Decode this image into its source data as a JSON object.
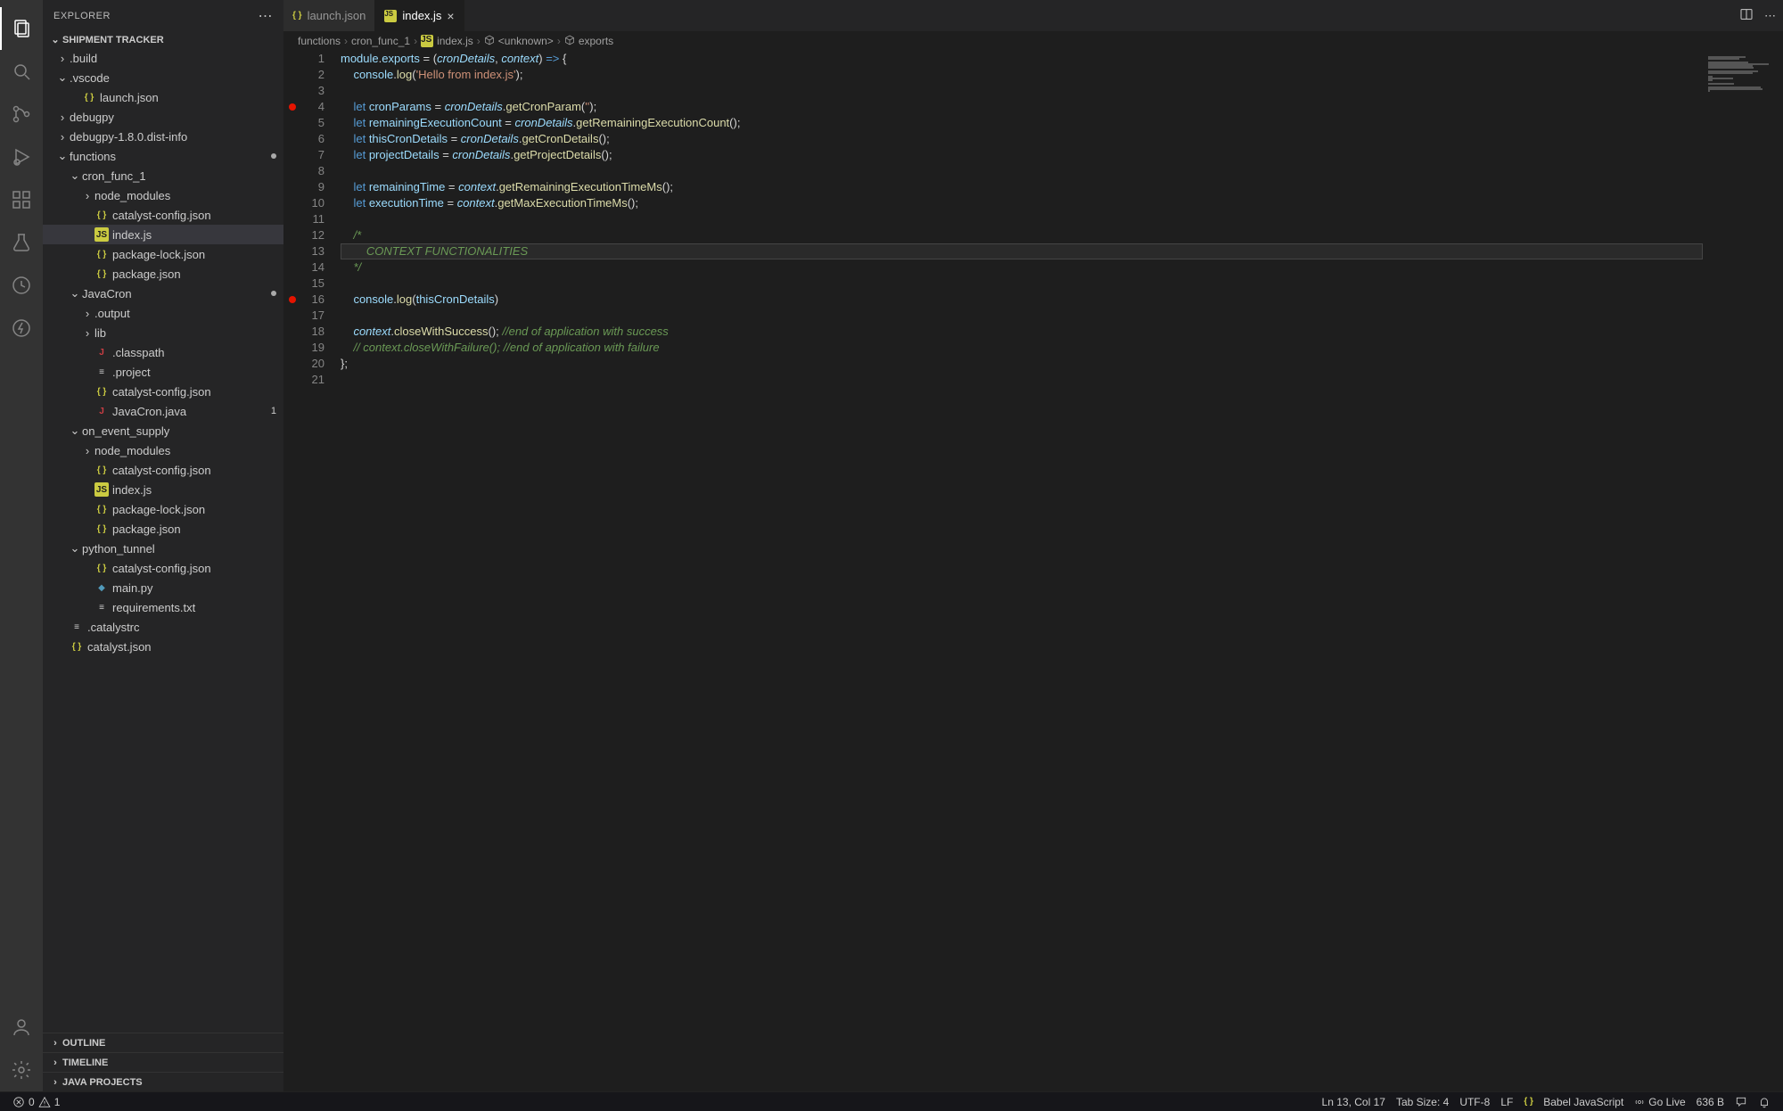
{
  "sidebar": {
    "title": "EXPLORER",
    "root": "SHIPMENT TRACKER",
    "panels": {
      "outline": "OUTLINE",
      "timeline": "TIMELINE",
      "java": "JAVA PROJECTS"
    }
  },
  "tree": [
    {
      "depth": 0,
      "type": "folder",
      "open": false,
      "label": ".build"
    },
    {
      "depth": 0,
      "type": "folder",
      "open": true,
      "label": ".vscode"
    },
    {
      "depth": 1,
      "type": "file",
      "icon": "json",
      "label": "launch.json"
    },
    {
      "depth": 0,
      "type": "folder",
      "open": false,
      "label": "debugpy"
    },
    {
      "depth": 0,
      "type": "folder",
      "open": false,
      "label": "debugpy-1.8.0.dist-info"
    },
    {
      "depth": 0,
      "type": "folder",
      "open": true,
      "label": "functions",
      "dot": true
    },
    {
      "depth": 1,
      "type": "folder",
      "open": true,
      "label": "cron_func_1"
    },
    {
      "depth": 2,
      "type": "folder",
      "open": false,
      "label": "node_modules"
    },
    {
      "depth": 2,
      "type": "file",
      "icon": "json",
      "label": "catalyst-config.json"
    },
    {
      "depth": 2,
      "type": "file",
      "icon": "js",
      "label": "index.js",
      "selected": true
    },
    {
      "depth": 2,
      "type": "file",
      "icon": "json",
      "label": "package-lock.json"
    },
    {
      "depth": 2,
      "type": "file",
      "icon": "json",
      "label": "package.json"
    },
    {
      "depth": 1,
      "type": "folder",
      "open": true,
      "label": "JavaCron",
      "dot": true
    },
    {
      "depth": 2,
      "type": "folder",
      "open": false,
      "label": ".output"
    },
    {
      "depth": 2,
      "type": "folder",
      "open": false,
      "label": "lib"
    },
    {
      "depth": 2,
      "type": "file",
      "icon": "java",
      "label": ".classpath"
    },
    {
      "depth": 2,
      "type": "file",
      "icon": "txt",
      "label": ".project"
    },
    {
      "depth": 2,
      "type": "file",
      "icon": "json",
      "label": "catalyst-config.json"
    },
    {
      "depth": 2,
      "type": "file",
      "icon": "java",
      "label": "JavaCron.java",
      "badge": "1"
    },
    {
      "depth": 1,
      "type": "folder",
      "open": true,
      "label": "on_event_supply"
    },
    {
      "depth": 2,
      "type": "folder",
      "open": false,
      "label": "node_modules"
    },
    {
      "depth": 2,
      "type": "file",
      "icon": "json",
      "label": "catalyst-config.json"
    },
    {
      "depth": 2,
      "type": "file",
      "icon": "js",
      "label": "index.js"
    },
    {
      "depth": 2,
      "type": "file",
      "icon": "json",
      "label": "package-lock.json"
    },
    {
      "depth": 2,
      "type": "file",
      "icon": "json",
      "label": "package.json"
    },
    {
      "depth": 1,
      "type": "folder",
      "open": true,
      "label": "python_tunnel"
    },
    {
      "depth": 2,
      "type": "file",
      "icon": "json",
      "label": "catalyst-config.json"
    },
    {
      "depth": 2,
      "type": "file",
      "icon": "py",
      "label": "main.py"
    },
    {
      "depth": 2,
      "type": "file",
      "icon": "txt",
      "label": "requirements.txt"
    },
    {
      "depth": 0,
      "type": "file",
      "icon": "txt",
      "label": ".catalystrc"
    },
    {
      "depth": 0,
      "type": "file",
      "icon": "json",
      "label": "catalyst.json"
    }
  ],
  "tabs": [
    {
      "icon": "json",
      "label": "launch.json",
      "active": false
    },
    {
      "icon": "js",
      "label": "index.js",
      "active": true,
      "close": true
    }
  ],
  "breadcrumb": [
    "functions",
    "cron_func_1",
    "index.js",
    "<unknown>",
    "exports"
  ],
  "breadcrumb_icons": [
    "",
    "",
    "js",
    "cube",
    "cube"
  ],
  "code_lines": 21,
  "breakpoints": [
    4,
    16
  ],
  "highlighted_line": 13,
  "code": [
    "<span class='k-lightblue'>module</span>.<span class='k-lightblue'>exports</span> = (<span class='k-param'>cronDetails</span>, <span class='k-param'>context</span>) <span class='k-blue'>=&gt;</span> {",
    "    <span class='k-lightblue'>console</span>.<span class='k-func'>log</span>(<span class='k-string'>'Hello from index.js'</span>);",
    "",
    "    <span class='k-blue'>let</span> <span class='k-lightblue'>cronParams</span> = <span class='k-param'>cronDetails</span>.<span class='k-func'>getCronParam</span>(<span class='k-string'>''</span>);",
    "    <span class='k-blue'>let</span> <span class='k-lightblue'>remainingExecutionCount</span> = <span class='k-param'>cronDetails</span>.<span class='k-func'>getRemainingExecutionCount</span>();",
    "    <span class='k-blue'>let</span> <span class='k-lightblue'>thisCronDetails</span> = <span class='k-param'>cronDetails</span>.<span class='k-func'>getCronDetails</span>();",
    "    <span class='k-blue'>let</span> <span class='k-lightblue'>projectDetails</span> = <span class='k-param'>cronDetails</span>.<span class='k-func'>getProjectDetails</span>();",
    "",
    "    <span class='k-blue'>let</span> <span class='k-lightblue'>remainingTime</span> = <span class='k-param'>context</span>.<span class='k-func'>getRemainingExecutionTimeMs</span>();",
    "    <span class='k-blue'>let</span> <span class='k-lightblue'>executionTime</span> = <span class='k-param'>context</span>.<span class='k-func'>getMaxExecutionTimeMs</span>();",
    "",
    "    <span class='k-comment'>/*</span>",
    "<span class='k-comment'>        CONTEXT FUNCTIONALITIES</span>",
    "    <span class='k-comment'>*/</span>",
    "",
    "    <span class='k-lightblue'>console</span>.<span class='k-func'>log</span>(<span class='k-lightblue'>thisCronDetails</span>)",
    "",
    "    <span class='k-param'>context</span>.<span class='k-func'>closeWithSuccess</span>(); <span class='k-comment'>//end of application with success</span>",
    "    <span class='k-comment'>// context.closeWithFailure(); //end of application with failure</span>",
    "};",
    ""
  ],
  "status": {
    "errors": "0",
    "warnings": "1",
    "cursor": "Ln 13, Col 17",
    "tabsize": "Tab Size: 4",
    "encoding": "UTF-8",
    "eol": "LF",
    "language": "Babel JavaScript",
    "golive": "Go Live",
    "filesize": "636 B"
  }
}
